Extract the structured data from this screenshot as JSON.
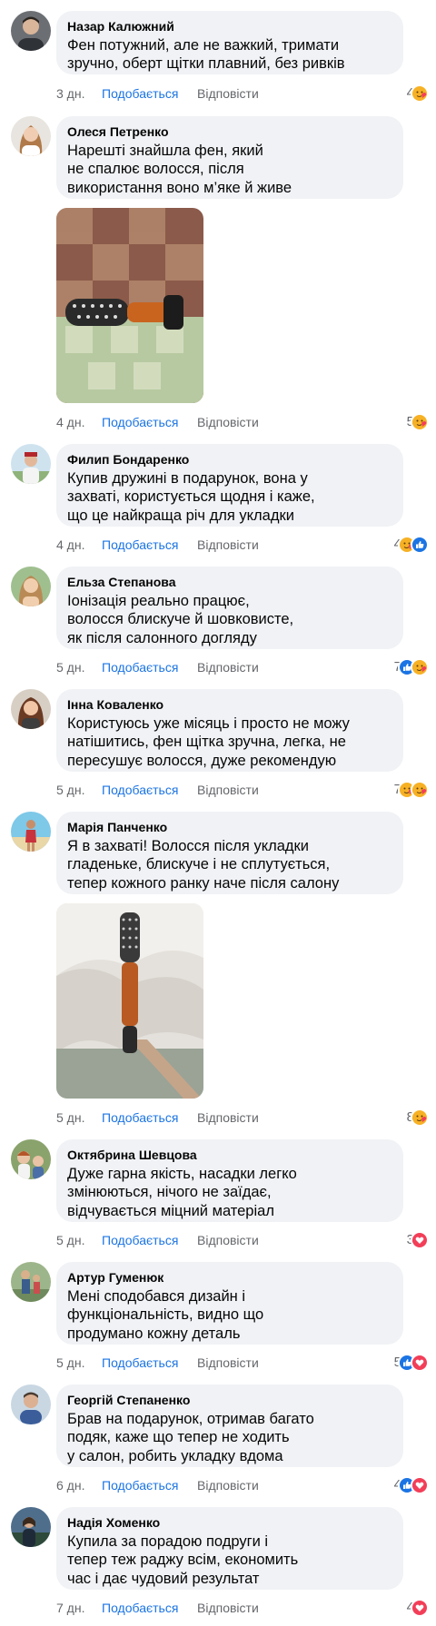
{
  "comments": [
    {
      "author": "Назар Калюжний",
      "text_lines": [
        "Фен потужний, але не важкий, тримати",
        "зручно, оберт щітки плавний, без ривків"
      ],
      "time": "3 дн.",
      "like": "Подобається",
      "reply": "Відповісти",
      "reaction_count": "4",
      "reactions": [
        "care"
      ]
    },
    {
      "author": "Олеся Петренко",
      "text_lines": [
        "Нарешті знайшла фен, який",
        "не спалює волосся, після",
        "використання воно м’яке й живе"
      ],
      "time": "4 дн.",
      "like": "Подобається",
      "reply": "Відповісти",
      "reaction_count": "5",
      "reactions": [
        "care"
      ]
    },
    {
      "author": "Филип Бондаренко",
      "text_lines": [
        "Купив дружині в подарунок, вона у",
        "захваті, користується щодня і каже,",
        "що це найкраща річ для укладки"
      ],
      "time": "4 дн.",
      "like": "Подобається",
      "reply": "Відповісти",
      "reaction_count": "4",
      "reactions": [
        "care",
        "like"
      ]
    },
    {
      "author": "Ельза Степанова",
      "text_lines": [
        "Іонізація реально працює,",
        "волосся блискуче й шовковисте,",
        "як після салонного догляду"
      ],
      "time": "5 дн.",
      "like": "Подобається",
      "reply": "Відповісти",
      "reaction_count": "7",
      "reactions": [
        "like",
        "care"
      ]
    },
    {
      "author": "Інна Коваленко",
      "text_lines": [
        "Користуюсь уже місяць і просто не можу",
        "натішитись, фен щітка зручна, легка, не",
        "пересушує волосся, дуже рекомендую"
      ],
      "time": "5 дн.",
      "like": "Подобається",
      "reply": "Відповісти",
      "reaction_count": "7",
      "reactions": [
        "care",
        "care"
      ]
    },
    {
      "author": "Марія Панченко",
      "text_lines": [
        "Я в захваті! Волосся після укладки",
        "гладеньке, блискуче і не сплутується,",
        "тепер кожного ранку наче після салону"
      ],
      "time": "5 дн.",
      "like": "Подобається",
      "reply": "Відповісти",
      "reaction_count": "8",
      "reactions": [
        "care"
      ]
    },
    {
      "author": "Октябрина Шевцова",
      "text_lines": [
        "Дуже гарна якість, насадки легко",
        "змінюються, нічого не заїдає,",
        "відчувається міцний матеріал"
      ],
      "time": "5 дн.",
      "like": "Подобається",
      "reply": "Відповісти",
      "reaction_count": "3",
      "reactions": [
        "love"
      ]
    },
    {
      "author": "Артур Гуменюк",
      "text_lines": [
        "Мені сподобався дизайн і",
        "функціональність, видно що",
        "продумано кожну деталь"
      ],
      "time": "5 дн.",
      "like": "Подобається",
      "reply": "Відповісти",
      "reaction_count": "5",
      "reactions": [
        "like",
        "love"
      ]
    },
    {
      "author": "Георгій Степаненко",
      "text_lines": [
        "Брав на подарунок, отримав багато",
        "подяк, каже що тепер не ходить",
        "у салон, робить укладку вдома"
      ],
      "time": "6 дн.",
      "like": "Подобається",
      "reply": "Відповісти",
      "reaction_count": "4",
      "reactions": [
        "like",
        "love"
      ]
    },
    {
      "author": "Надія Хоменко",
      "text_lines": [
        "Купила за порадою подруги і",
        "тепер теж раджу всім, економить",
        "час і дає чудовий результат"
      ],
      "time": "7 дн.",
      "like": "Подобається",
      "reply": "Відповісти",
      "reaction_count": "4",
      "reactions": [
        "love"
      ]
    }
  ],
  "colors": {
    "bubble": "#f0f2f5",
    "like_blue": "#1b74e4",
    "meta_gray": "#65676b",
    "love_red": "#f33e58",
    "care_yellow": "#f7b125"
  }
}
